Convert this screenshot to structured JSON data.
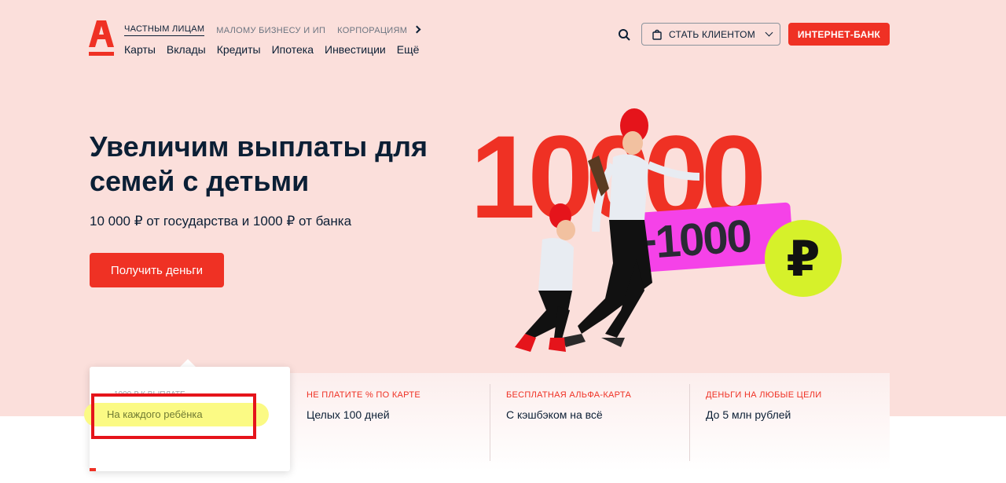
{
  "header": {
    "top_nav": [
      "ЧАСТНЫМ ЛИЦАМ",
      "МАЛОМУ БИЗНЕСУ И ИП",
      "КОРПОРАЦИЯМ"
    ],
    "sub_nav": [
      "Карты",
      "Вклады",
      "Кредиты",
      "Ипотека",
      "Инвестиции",
      "Ещё"
    ],
    "become_client": "СТАТЬ КЛИЕНТОМ",
    "internet_bank": "ИНТЕРНЕТ-БАНК"
  },
  "hero": {
    "title": "Увеличим выплаты для семей с детьми",
    "subtitle": "10 000 ₽ от государства и 1000 ₽ от банка",
    "cta": "Получить деньги",
    "big_number": "10000",
    "plus": "+1000",
    "currency": "₽"
  },
  "features": [
    {
      "label": "1000 ₽ к выплате",
      "value": "На каждого ребёнка"
    },
    {
      "label": "НЕ ПЛАТИТЕ % ПО КАРТЕ",
      "value": "Целых 100 дней"
    },
    {
      "label": "БЕСПЛАТНАЯ АЛЬФА-КАРТА",
      "value": "С кэшбэком на всё"
    },
    {
      "label": "ДЕНЬГИ НА ЛЮБЫЕ ЦЕЛИ",
      "value": "До 5 млн рублей"
    }
  ],
  "colors": {
    "brand": "#ef3124",
    "background": "#fbdfdb",
    "highlight": "#fbfa84",
    "annotation": "#e5141b"
  }
}
